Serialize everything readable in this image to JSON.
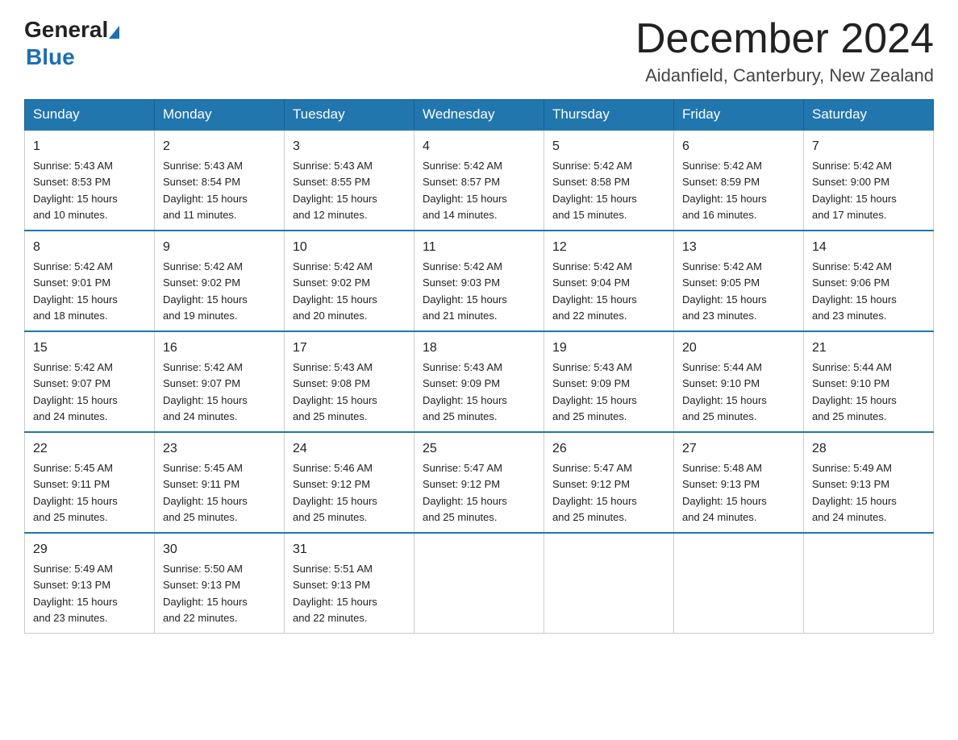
{
  "header": {
    "logo_general": "General",
    "logo_blue": "Blue",
    "month_title": "December 2024",
    "location": "Aidanfield, Canterbury, New Zealand"
  },
  "days_of_week": [
    "Sunday",
    "Monday",
    "Tuesday",
    "Wednesday",
    "Thursday",
    "Friday",
    "Saturday"
  ],
  "weeks": [
    [
      {
        "day": "1",
        "sunrise": "5:43 AM",
        "sunset": "8:53 PM",
        "daylight": "15 hours and 10 minutes."
      },
      {
        "day": "2",
        "sunrise": "5:43 AM",
        "sunset": "8:54 PM",
        "daylight": "15 hours and 11 minutes."
      },
      {
        "day": "3",
        "sunrise": "5:43 AM",
        "sunset": "8:55 PM",
        "daylight": "15 hours and 12 minutes."
      },
      {
        "day": "4",
        "sunrise": "5:42 AM",
        "sunset": "8:57 PM",
        "daylight": "15 hours and 14 minutes."
      },
      {
        "day": "5",
        "sunrise": "5:42 AM",
        "sunset": "8:58 PM",
        "daylight": "15 hours and 15 minutes."
      },
      {
        "day": "6",
        "sunrise": "5:42 AM",
        "sunset": "8:59 PM",
        "daylight": "15 hours and 16 minutes."
      },
      {
        "day": "7",
        "sunrise": "5:42 AM",
        "sunset": "9:00 PM",
        "daylight": "15 hours and 17 minutes."
      }
    ],
    [
      {
        "day": "8",
        "sunrise": "5:42 AM",
        "sunset": "9:01 PM",
        "daylight": "15 hours and 18 minutes."
      },
      {
        "day": "9",
        "sunrise": "5:42 AM",
        "sunset": "9:02 PM",
        "daylight": "15 hours and 19 minutes."
      },
      {
        "day": "10",
        "sunrise": "5:42 AM",
        "sunset": "9:02 PM",
        "daylight": "15 hours and 20 minutes."
      },
      {
        "day": "11",
        "sunrise": "5:42 AM",
        "sunset": "9:03 PM",
        "daylight": "15 hours and 21 minutes."
      },
      {
        "day": "12",
        "sunrise": "5:42 AM",
        "sunset": "9:04 PM",
        "daylight": "15 hours and 22 minutes."
      },
      {
        "day": "13",
        "sunrise": "5:42 AM",
        "sunset": "9:05 PM",
        "daylight": "15 hours and 23 minutes."
      },
      {
        "day": "14",
        "sunrise": "5:42 AM",
        "sunset": "9:06 PM",
        "daylight": "15 hours and 23 minutes."
      }
    ],
    [
      {
        "day": "15",
        "sunrise": "5:42 AM",
        "sunset": "9:07 PM",
        "daylight": "15 hours and 24 minutes."
      },
      {
        "day": "16",
        "sunrise": "5:42 AM",
        "sunset": "9:07 PM",
        "daylight": "15 hours and 24 minutes."
      },
      {
        "day": "17",
        "sunrise": "5:43 AM",
        "sunset": "9:08 PM",
        "daylight": "15 hours and 25 minutes."
      },
      {
        "day": "18",
        "sunrise": "5:43 AM",
        "sunset": "9:09 PM",
        "daylight": "15 hours and 25 minutes."
      },
      {
        "day": "19",
        "sunrise": "5:43 AM",
        "sunset": "9:09 PM",
        "daylight": "15 hours and 25 minutes."
      },
      {
        "day": "20",
        "sunrise": "5:44 AM",
        "sunset": "9:10 PM",
        "daylight": "15 hours and 25 minutes."
      },
      {
        "day": "21",
        "sunrise": "5:44 AM",
        "sunset": "9:10 PM",
        "daylight": "15 hours and 25 minutes."
      }
    ],
    [
      {
        "day": "22",
        "sunrise": "5:45 AM",
        "sunset": "9:11 PM",
        "daylight": "15 hours and 25 minutes."
      },
      {
        "day": "23",
        "sunrise": "5:45 AM",
        "sunset": "9:11 PM",
        "daylight": "15 hours and 25 minutes."
      },
      {
        "day": "24",
        "sunrise": "5:46 AM",
        "sunset": "9:12 PM",
        "daylight": "15 hours and 25 minutes."
      },
      {
        "day": "25",
        "sunrise": "5:47 AM",
        "sunset": "9:12 PM",
        "daylight": "15 hours and 25 minutes."
      },
      {
        "day": "26",
        "sunrise": "5:47 AM",
        "sunset": "9:12 PM",
        "daylight": "15 hours and 25 minutes."
      },
      {
        "day": "27",
        "sunrise": "5:48 AM",
        "sunset": "9:13 PM",
        "daylight": "15 hours and 24 minutes."
      },
      {
        "day": "28",
        "sunrise": "5:49 AM",
        "sunset": "9:13 PM",
        "daylight": "15 hours and 24 minutes."
      }
    ],
    [
      {
        "day": "29",
        "sunrise": "5:49 AM",
        "sunset": "9:13 PM",
        "daylight": "15 hours and 23 minutes."
      },
      {
        "day": "30",
        "sunrise": "5:50 AM",
        "sunset": "9:13 PM",
        "daylight": "15 hours and 22 minutes."
      },
      {
        "day": "31",
        "sunrise": "5:51 AM",
        "sunset": "9:13 PM",
        "daylight": "15 hours and 22 minutes."
      },
      null,
      null,
      null,
      null
    ]
  ],
  "labels": {
    "sunrise": "Sunrise:",
    "sunset": "Sunset:",
    "daylight": "Daylight:"
  }
}
